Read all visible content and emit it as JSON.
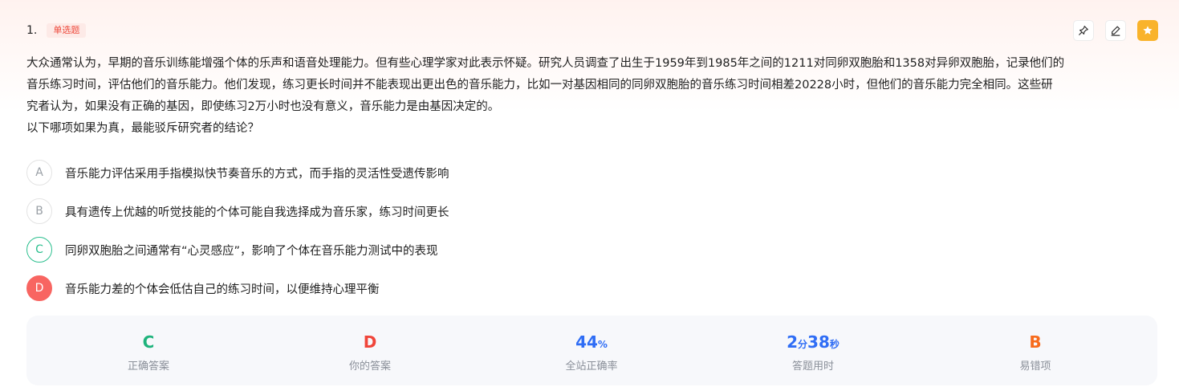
{
  "question": {
    "number": "1.",
    "type": "单选题",
    "stem_lines": [
      "大众通常认为，早期的音乐训练能增强个体的乐声和语音处理能力。但有些心理学家对此表示怀疑。研究人员调查了出生于1959年到1985年之间的1211对同卵双胞胎和1358对异卵双胞胎，记录他们的",
      "音乐练习时间，评估他们的音乐能力。他们发现，练习更长时间并不能表现出更出色的音乐能力，比如一对基因相同的同卵双胞胎的音乐练习时间相差20228小时，但他们的音乐能力完全相同。这些研",
      "究者认为，如果没有正确的基因，即使练习2万小时也没有意义，音乐能力是由基因决定的。",
      "以下哪项如果为真，最能驳斥研究者的结论？"
    ]
  },
  "toolbar": {
    "pin_icon": "pin-icon",
    "edit_icon": "edit-icon",
    "star_icon": "star-icon",
    "star_color": "#f9b32b"
  },
  "options": [
    {
      "letter": "A",
      "text": "音乐能力评估采用手指模拟快节奏音乐的方式，而手指的灵活性受遗传影响",
      "state": "normal"
    },
    {
      "letter": "B",
      "text": "具有遗传上优越的听觉技能的个体可能自我选择成为音乐家，练习时间更长",
      "state": "normal"
    },
    {
      "letter": "C",
      "text": "同卵双胞胎之间通常有“心灵感应”，影响了个体在音乐能力测试中的表现",
      "state": "correct"
    },
    {
      "letter": "D",
      "text": "音乐能力差的个体会低估自己的练习时间，以便维持心理平衡",
      "state": "selected-wrong"
    }
  ],
  "stats": {
    "correct_answer": {
      "value": "C",
      "label": "正确答案",
      "color": "#1fb37c"
    },
    "your_answer": {
      "value": "D",
      "label": "你的答案",
      "color": "#f0453a"
    },
    "accuracy": {
      "value": "44",
      "unit": "%",
      "label": "全站正确率",
      "color": "#2f6df5"
    },
    "time": {
      "minutes": "2",
      "min_unit": "分",
      "seconds": "38",
      "sec_unit": "秒",
      "label": "答题用时",
      "color": "#2f6df5"
    },
    "common_wrong": {
      "value": "B",
      "label": "易错项",
      "color": "#f76b1c"
    }
  },
  "colors": {
    "correct": "#2bbf8e",
    "wrong": "#f86561",
    "tag": "#ee4a3c"
  }
}
